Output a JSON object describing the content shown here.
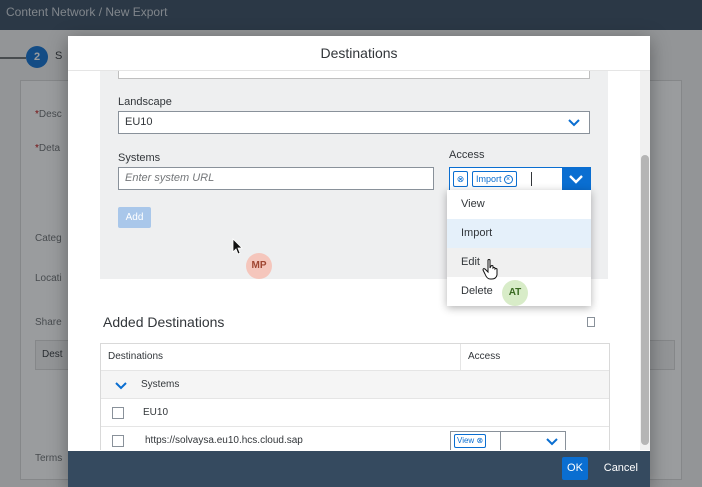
{
  "background": {
    "breadcrumb": "Content Network  /  New Export",
    "step_number": "2",
    "step_label": "S",
    "labels": {
      "description": "Desc",
      "details": "Deta",
      "category": "Categ",
      "location": "Locati",
      "shared": "Share",
      "destinations": "Dest",
      "terms": "Terms"
    }
  },
  "dialog": {
    "title": "Destinations",
    "landscape_label": "Landscape",
    "landscape_value": "EU10",
    "systems_label": "Systems",
    "systems_placeholder": "Enter system URL",
    "access_label": "Access",
    "access_token": "Import",
    "add_button": "Add",
    "access_options": [
      "View",
      "Import",
      "Edit",
      "Delete"
    ],
    "added_title": "Added Destinations",
    "table_headers": [
      "Destinations",
      "Access"
    ],
    "group_label": "Systems",
    "rows": [
      {
        "label": "EU10"
      },
      {
        "label": "https://solvaysa.eu10.hcs.cloud.sap",
        "access": "View"
      }
    ],
    "ok_button": "OK",
    "cancel_button": "Cancel"
  },
  "avatars": {
    "mp": "MP",
    "at": "AT"
  },
  "colors": {
    "accent": "#0a6ed1",
    "header_bg": "#354a5f",
    "avatar_mp": "#f5c6bc",
    "avatar_at": "#d8ecc8"
  }
}
